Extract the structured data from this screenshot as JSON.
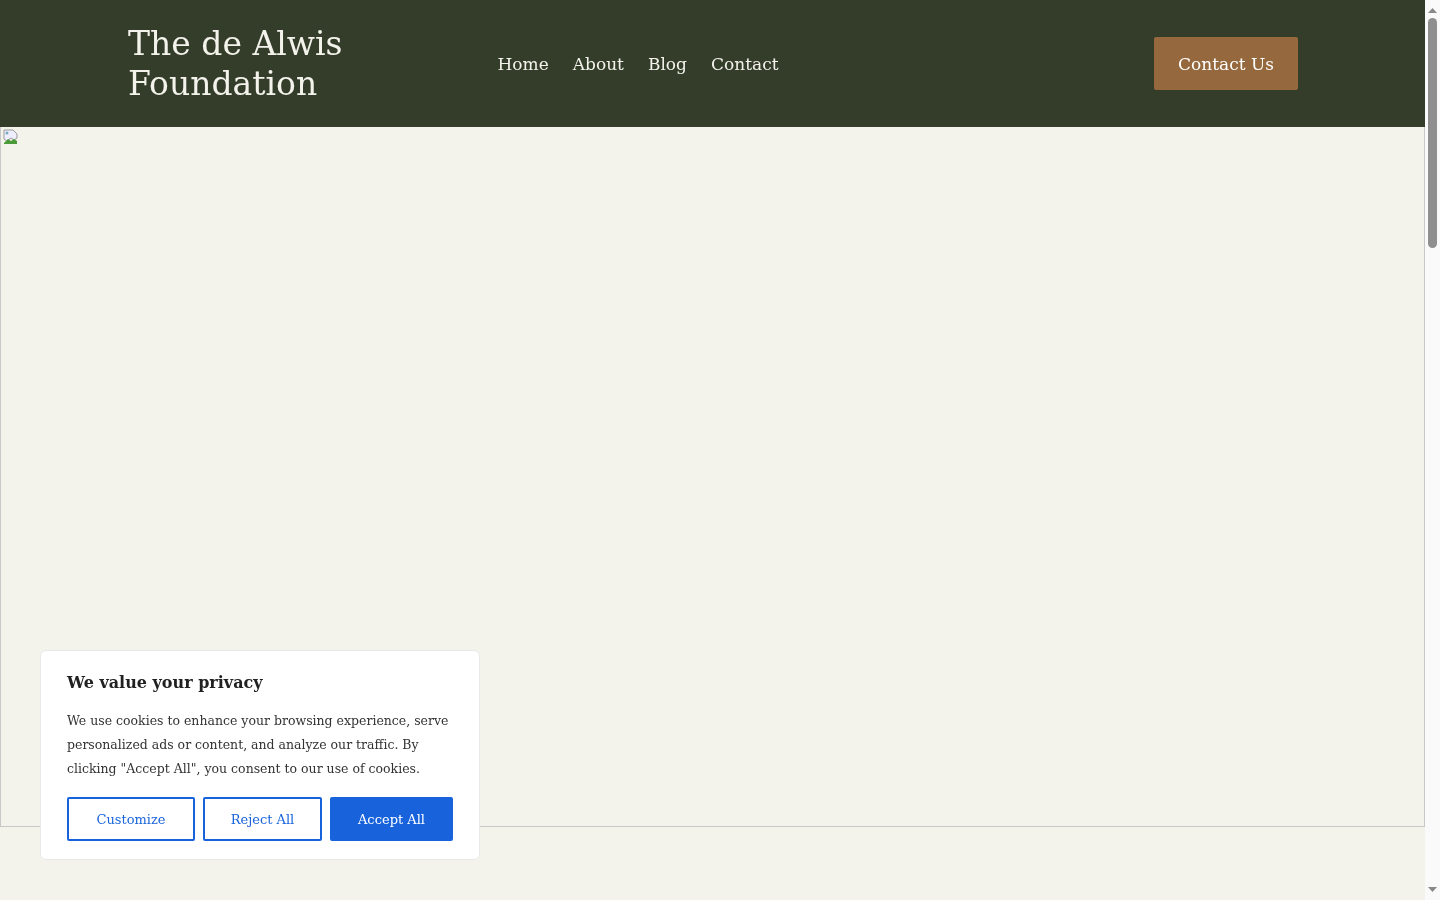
{
  "header": {
    "logo": "The de Alwis Foundation",
    "nav": [
      {
        "label": "Home"
      },
      {
        "label": "About"
      },
      {
        "label": "Blog"
      },
      {
        "label": "Contact"
      }
    ],
    "cta": "Contact Us"
  },
  "hero": {
    "kind": "broken-image"
  },
  "cookie_banner": {
    "title": "We value your privacy",
    "text": "We use cookies to enhance your browsing experience, serve personalized ads or content, and analyze our traffic. By clicking \"Accept All\", you consent to our use of cookies.",
    "buttons": [
      {
        "label": "Customize",
        "kind": "outline"
      },
      {
        "label": "Reject All",
        "kind": "outline"
      },
      {
        "label": "Accept All",
        "kind": "filled"
      }
    ]
  }
}
